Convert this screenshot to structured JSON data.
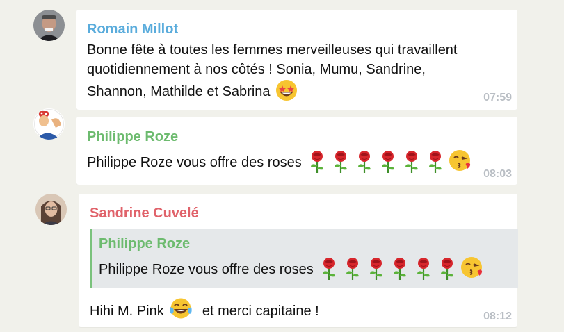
{
  "messages": [
    {
      "sender": "Romain Millot",
      "sender_color": "#5aacdc",
      "text_lines": [
        "Bonne fête à toutes les femmes merveilleuses qui travaillent",
        "quotidiennement à nos côtés ! Sonia, Mumu, Sandrine,",
        "Shannon, Mathilde et Sabrina"
      ],
      "emoji": "star-struck-face",
      "time": "07:59"
    },
    {
      "sender": "Philippe Roze",
      "sender_color": "#6dbb6f",
      "text": "Philippe Roze vous offre des roses",
      "emojis": [
        "rose",
        "rose",
        "rose",
        "rose",
        "rose",
        "rose",
        "kissing-face"
      ],
      "time": "08:03"
    },
    {
      "sender": "Sandrine Cuvelé",
      "sender_color": "#e0626a",
      "reply": {
        "sender": "Philippe Roze",
        "text": "Philippe Roze vous offre des roses",
        "emojis": [
          "rose",
          "rose",
          "rose",
          "rose",
          "rose",
          "rose",
          "kissing-face"
        ]
      },
      "text_before": "Hihi M. Pink",
      "emoji": "tears-of-joy-face",
      "text_after": "et merci capitaine !",
      "time": "08:12"
    }
  ]
}
